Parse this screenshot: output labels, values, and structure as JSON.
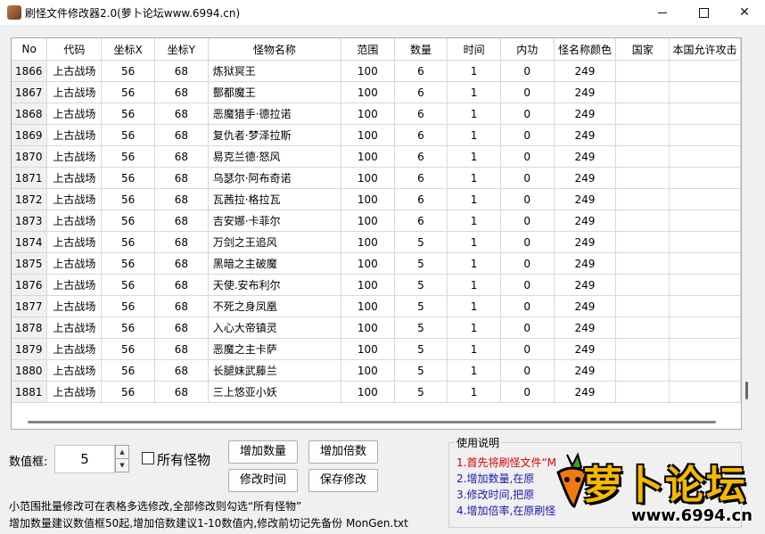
{
  "window": {
    "title": "刷怪文件修改器2.0(萝卜论坛www.6994.cn)"
  },
  "table": {
    "columns": [
      "No",
      "代码",
      "坐标X",
      "坐标Y",
      "怪物名称",
      "范围",
      "数量",
      "时间",
      "内功",
      "怪名称颜色",
      "国家",
      "本国允许攻击"
    ],
    "rows": [
      [
        "1866",
        "上古战场",
        "56",
        "68",
        "炼狱冥王",
        "100",
        "6",
        "1",
        "0",
        "249",
        "",
        ""
      ],
      [
        "1867",
        "上古战场",
        "56",
        "68",
        "酆都魔王",
        "100",
        "6",
        "1",
        "0",
        "249",
        "",
        ""
      ],
      [
        "1868",
        "上古战场",
        "56",
        "68",
        "恶魔猎手·德拉诺",
        "100",
        "6",
        "1",
        "0",
        "249",
        "",
        ""
      ],
      [
        "1869",
        "上古战场",
        "56",
        "68",
        "复仇者·梦泽拉斯",
        "100",
        "6",
        "1",
        "0",
        "249",
        "",
        ""
      ],
      [
        "1870",
        "上古战场",
        "56",
        "68",
        "易克兰德·怒风",
        "100",
        "6",
        "1",
        "0",
        "249",
        "",
        ""
      ],
      [
        "1871",
        "上古战场",
        "56",
        "68",
        "乌瑟尔·阿布奇诺",
        "100",
        "6",
        "1",
        "0",
        "249",
        "",
        ""
      ],
      [
        "1872",
        "上古战场",
        "56",
        "68",
        "瓦茜拉·格拉瓦",
        "100",
        "6",
        "1",
        "0",
        "249",
        "",
        ""
      ],
      [
        "1873",
        "上古战场",
        "56",
        "68",
        "吉安娜·卡菲尔",
        "100",
        "6",
        "1",
        "0",
        "249",
        "",
        ""
      ],
      [
        "1874",
        "上古战场",
        "56",
        "68",
        "万剑之王追风",
        "100",
        "5",
        "1",
        "0",
        "249",
        "",
        ""
      ],
      [
        "1875",
        "上古战场",
        "56",
        "68",
        "黑暗之主破魔",
        "100",
        "5",
        "1",
        "0",
        "249",
        "",
        ""
      ],
      [
        "1876",
        "上古战场",
        "56",
        "68",
        "天使.安布利尔",
        "100",
        "5",
        "1",
        "0",
        "249",
        "",
        ""
      ],
      [
        "1877",
        "上古战场",
        "56",
        "68",
        "不死之身凤凰",
        "100",
        "5",
        "1",
        "0",
        "249",
        "",
        ""
      ],
      [
        "1878",
        "上古战场",
        "56",
        "68",
        "入心大帝镇灵",
        "100",
        "5",
        "1",
        "0",
        "249",
        "",
        ""
      ],
      [
        "1879",
        "上古战场",
        "56",
        "68",
        "恶魔之主卡萨",
        "100",
        "5",
        "1",
        "0",
        "249",
        "",
        ""
      ],
      [
        "1880",
        "上古战场",
        "56",
        "68",
        "长腿妹武藤兰",
        "100",
        "5",
        "1",
        "0",
        "249",
        "",
        ""
      ],
      [
        "1881",
        "上古战场",
        "56",
        "68",
        "三上悠亚小妖",
        "100",
        "5",
        "1",
        "0",
        "249",
        "",
        ""
      ]
    ]
  },
  "controls": {
    "value_label": "数值框:",
    "value": "5",
    "all_monsters_label": "所有怪物",
    "add_count": "增加数量",
    "add_multiplier": "增加倍数",
    "modify_time": "修改时间",
    "save": "保存修改",
    "tip1": "小范围批量修改可在表格多选修改,全部修改则勾选“所有怪物”",
    "tip2": "增加数量建议数值框50起,增加倍数建议1-10数值内,修改前切记先备份 MonGen.txt"
  },
  "help": {
    "title": "使用说明",
    "lines": [
      "1.首先将刷怪文件“M",
      "2.增加数量,在原",
      "3.修改时间,把原",
      "4.增加倍率,在原刷怪"
    ]
  },
  "logo": {
    "text": "萝卜论坛",
    "url": "www.6994.cn"
  }
}
